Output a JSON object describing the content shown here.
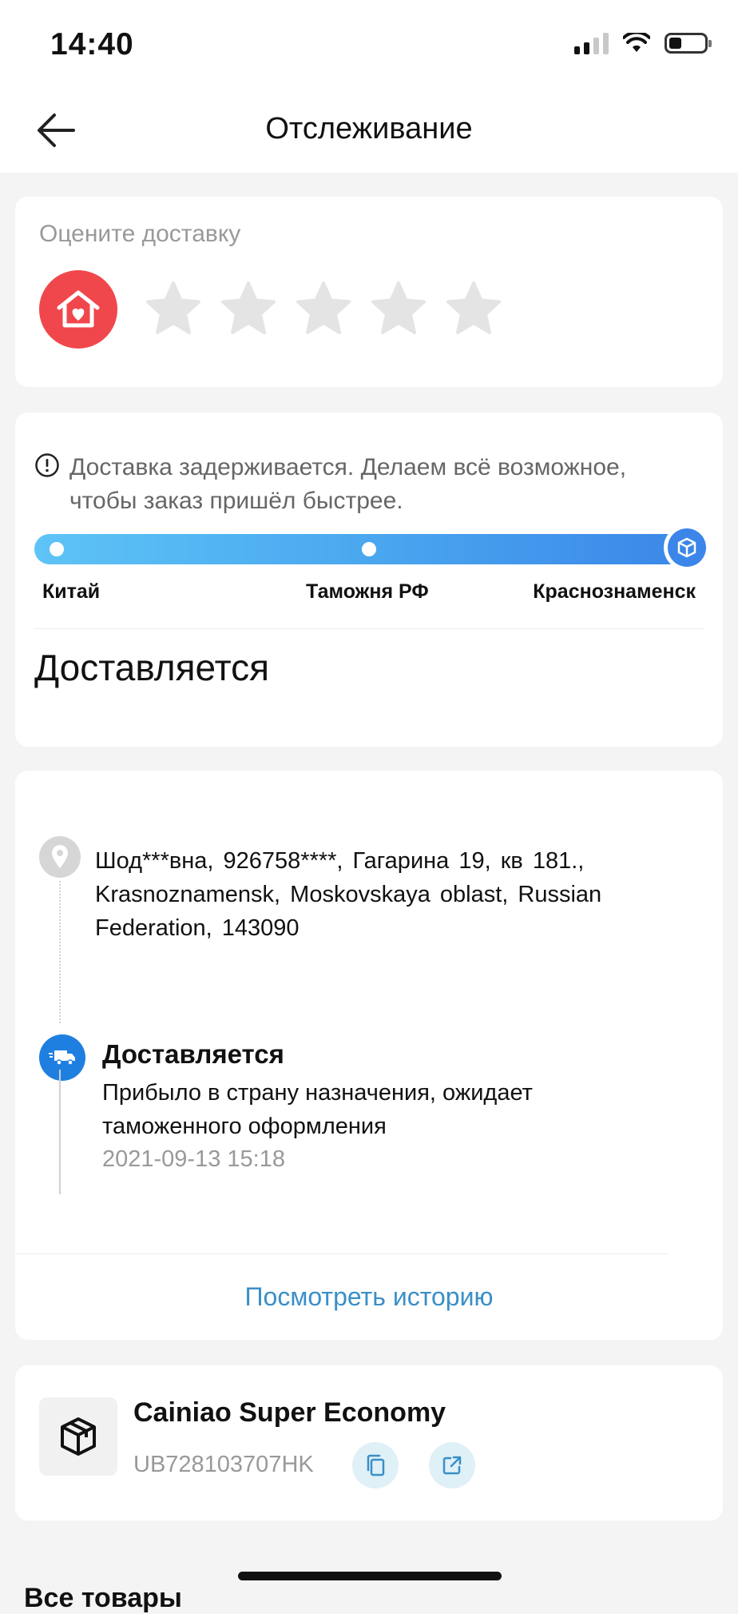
{
  "status_bar": {
    "time": "14:40",
    "signal_bars_active": 2,
    "signal_bars_total": 4,
    "battery_level": 0.35
  },
  "navbar": {
    "title": "Отслеживание",
    "back_icon": "arrow-left-icon"
  },
  "rating": {
    "title": "Оцените доставку",
    "brand_icon": "home-heart-icon",
    "stars_total": 5,
    "stars_selected": 0,
    "brand_color": "#f0474d"
  },
  "delivery_status": {
    "warning_icon": "exclamation-circle-icon",
    "warning_text": "Доставка задерживается. Делаем всё возможное, чтобы заказ пришёл быстрее.",
    "stages": [
      "Китай",
      "Таможня РФ",
      "Краснознаменск"
    ],
    "current_stage_icon": "package-icon",
    "status": "Доставляется",
    "progress_colors": [
      "#5ec4f6",
      "#3b86e8"
    ]
  },
  "tracking": {
    "address_icon": "location-pin-icon",
    "address": "Шод***вна,  926758****,  Гагарина 19, кв 181.,  Krasnoznamensk,  Moskovskaya oblast,  Russian Federation,  143090",
    "event_icon": "truck-icon",
    "event_title": "Доставляется",
    "event_description": "Прибыло в страну назначения, ожидает таможенного оформления",
    "event_time": "2021-09-13 15:18",
    "history_link": "Посмотреть историю"
  },
  "carrier": {
    "icon": "box-icon",
    "name": "Cainiao Super Economy",
    "tracking_number": "UB728103707HK",
    "copy_icon": "copy-icon",
    "open_icon": "external-link-icon"
  },
  "bottom_section_title": "Все товары"
}
